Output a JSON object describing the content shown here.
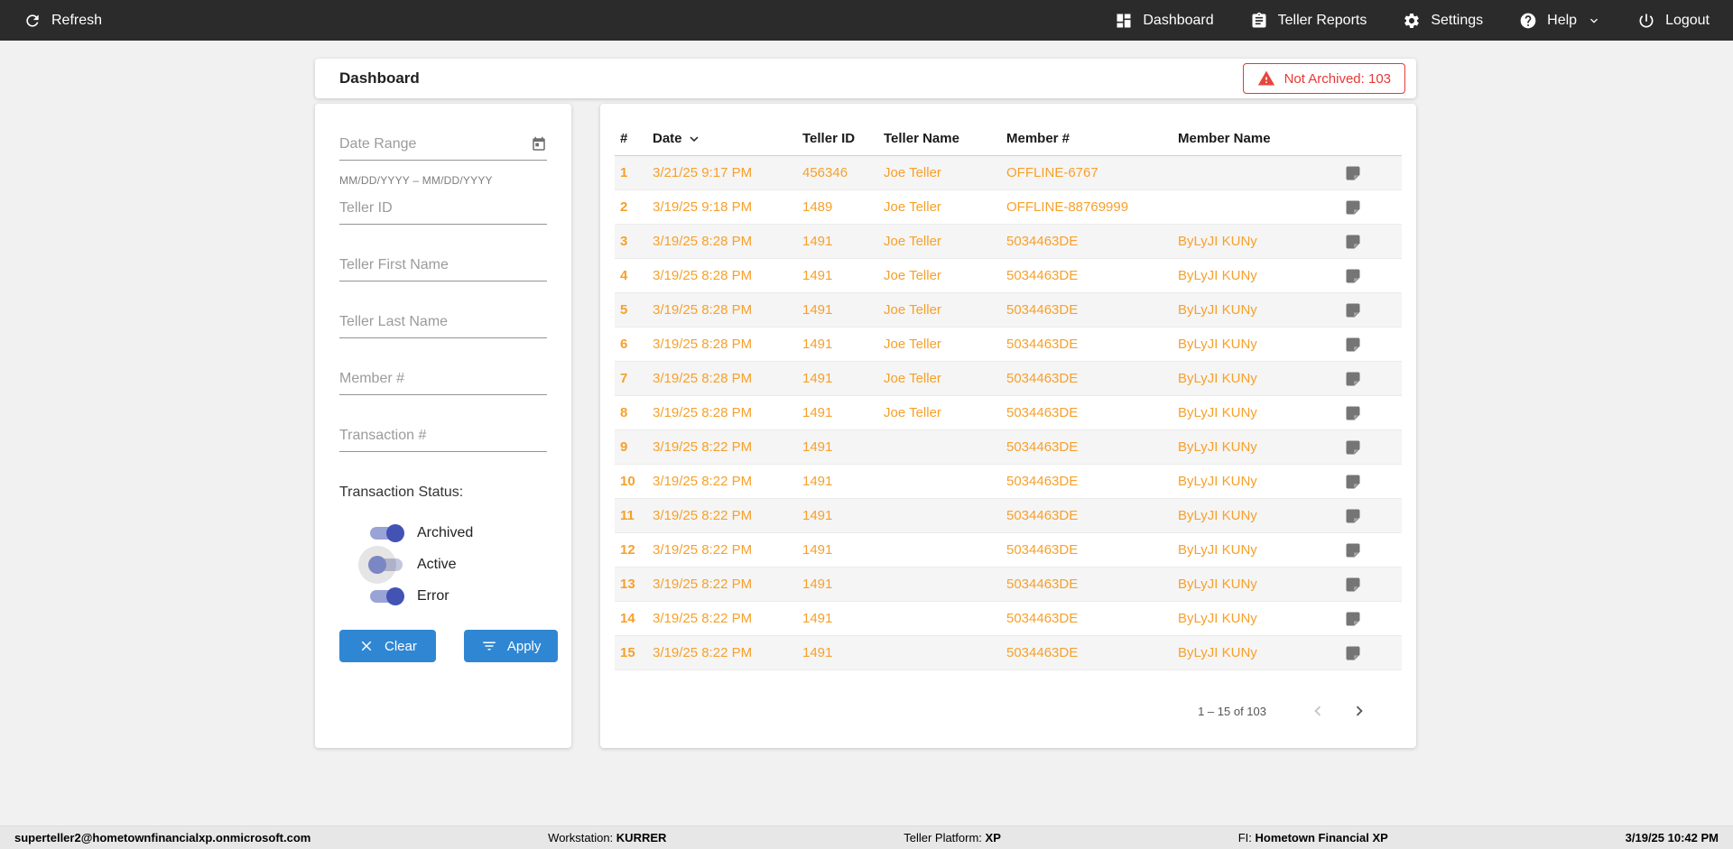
{
  "topnav": {
    "refresh_label": "Refresh",
    "items": [
      {
        "icon": "dashboard-icon",
        "label": "Dashboard"
      },
      {
        "icon": "clipboard-icon",
        "label": "Teller Reports"
      },
      {
        "icon": "gear-icon",
        "label": "Settings"
      },
      {
        "icon": "help-icon",
        "label": "Help"
      },
      {
        "icon": "power-icon",
        "label": "Logout"
      }
    ]
  },
  "titlebar": {
    "title": "Dashboard",
    "badge_text": "Not Archived: 103"
  },
  "filters": {
    "date_range": {
      "placeholder": "Date Range",
      "helper": "MM/DD/YYYY – MM/DD/YYYY"
    },
    "teller_id_placeholder": "Teller ID",
    "teller_first_name_placeholder": "Teller First Name",
    "teller_last_name_placeholder": "Teller Last Name",
    "member_num_placeholder": "Member #",
    "transaction_num_placeholder": "Transaction #",
    "status_label": "Transaction Status:",
    "toggles": [
      {
        "label": "Archived",
        "on": true
      },
      {
        "label": "Active",
        "on": false
      },
      {
        "label": "Error",
        "on": true
      }
    ],
    "clear_label": "Clear",
    "apply_label": "Apply"
  },
  "table": {
    "columns": [
      "#",
      "Date",
      "Teller ID",
      "Teller Name",
      "Member #",
      "Member Name"
    ],
    "rows": [
      {
        "num": "1",
        "date": "3/21/25 9:17 PM",
        "teller_id": "456346",
        "teller_name": "Joe Teller",
        "member_num": "OFFLINE-6767",
        "member_name": ""
      },
      {
        "num": "2",
        "date": "3/19/25 9:18 PM",
        "teller_id": "1489",
        "teller_name": "Joe Teller",
        "member_num": "OFFLINE-88769999",
        "member_name": ""
      },
      {
        "num": "3",
        "date": "3/19/25 8:28 PM",
        "teller_id": "1491",
        "teller_name": "Joe Teller",
        "member_num": "5034463DE",
        "member_name": "ByLyJI KUNy"
      },
      {
        "num": "4",
        "date": "3/19/25 8:28 PM",
        "teller_id": "1491",
        "teller_name": "Joe Teller",
        "member_num": "5034463DE",
        "member_name": "ByLyJI KUNy"
      },
      {
        "num": "5",
        "date": "3/19/25 8:28 PM",
        "teller_id": "1491",
        "teller_name": "Joe Teller",
        "member_num": "5034463DE",
        "member_name": "ByLyJI KUNy"
      },
      {
        "num": "6",
        "date": "3/19/25 8:28 PM",
        "teller_id": "1491",
        "teller_name": "Joe Teller",
        "member_num": "5034463DE",
        "member_name": "ByLyJI KUNy"
      },
      {
        "num": "7",
        "date": "3/19/25 8:28 PM",
        "teller_id": "1491",
        "teller_name": "Joe Teller",
        "member_num": "5034463DE",
        "member_name": "ByLyJI KUNy"
      },
      {
        "num": "8",
        "date": "3/19/25 8:28 PM",
        "teller_id": "1491",
        "teller_name": "Joe Teller",
        "member_num": "5034463DE",
        "member_name": "ByLyJI KUNy"
      },
      {
        "num": "9",
        "date": "3/19/25 8:22 PM",
        "teller_id": "1491",
        "teller_name": "",
        "member_num": "5034463DE",
        "member_name": "ByLyJI KUNy"
      },
      {
        "num": "10",
        "date": "3/19/25 8:22 PM",
        "teller_id": "1491",
        "teller_name": "",
        "member_num": "5034463DE",
        "member_name": "ByLyJI KUNy"
      },
      {
        "num": "11",
        "date": "3/19/25 8:22 PM",
        "teller_id": "1491",
        "teller_name": "",
        "member_num": "5034463DE",
        "member_name": "ByLyJI KUNy"
      },
      {
        "num": "12",
        "date": "3/19/25 8:22 PM",
        "teller_id": "1491",
        "teller_name": "",
        "member_num": "5034463DE",
        "member_name": "ByLyJI KUNy"
      },
      {
        "num": "13",
        "date": "3/19/25 8:22 PM",
        "teller_id": "1491",
        "teller_name": "",
        "member_num": "5034463DE",
        "member_name": "ByLyJI KUNy"
      },
      {
        "num": "14",
        "date": "3/19/25 8:22 PM",
        "teller_id": "1491",
        "teller_name": "",
        "member_num": "5034463DE",
        "member_name": "ByLyJI KUNy"
      },
      {
        "num": "15",
        "date": "3/19/25 8:22 PM",
        "teller_id": "1491",
        "teller_name": "",
        "member_num": "5034463DE",
        "member_name": "ByLyJI KUNy"
      }
    ]
  },
  "pagination": {
    "range_text": "1 – 15 of 103"
  },
  "footer": {
    "user": "superteller2@hometownfinancialxp.onmicrosoft.com",
    "workstation_label": "Workstation:",
    "workstation_value": "KURRER",
    "platform_label": "Teller Platform:",
    "platform_value": "XP",
    "fi_label": "FI:",
    "fi_value": "Hometown Financial XP",
    "datetime": "3/19/25 10:42 PM"
  },
  "colors": {
    "nav_bg": "#2b2b2b",
    "accent_blue": "#2f87d3",
    "data_orange": "#f7a02a",
    "alert_red": "#e53935",
    "toggle_indigo": "#4353b4"
  }
}
